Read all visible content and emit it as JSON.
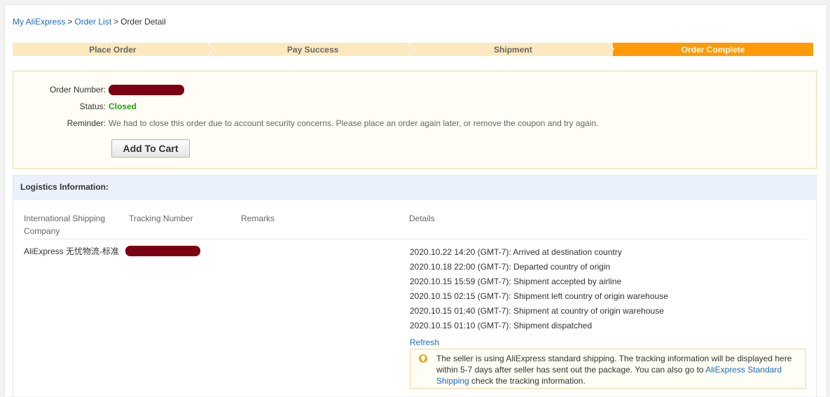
{
  "breadcrumb": {
    "home": "My AliExpress",
    "sep": ">",
    "orders": "Order List",
    "current": "Order Detail"
  },
  "steps": [
    "Place Order",
    "Pay Success",
    "Shipment",
    "Order Complete"
  ],
  "order": {
    "number_label": "Order Number:",
    "status_label": "Status:",
    "status_value": "Closed",
    "reminder_label": "Reminder:",
    "reminder_text": "We had to close this order due to account security concerns. Please place an order again later, or remove the coupon and try again.",
    "add_to_cart": "Add To Cart"
  },
  "logistics": {
    "title": "Logistics Information:",
    "headers": {
      "company_line1": "International Shipping",
      "company_line2": "Company",
      "tracking": "Tracking Number",
      "remarks": "Remarks",
      "details": "Details"
    },
    "company": "AliExpress 无忧物流-标准",
    "events": [
      "2020.10.22 14:20 (GMT-7): Arrived at destination country",
      "2020.10.18 22:00 (GMT-7): Departed country of origin",
      "2020.10.15 15:59 (GMT-7): Shipment accepted by airline",
      "2020.10.15 02:15 (GMT-7): Shipment left country of origin warehouse",
      "2020.10.15 01:40 (GMT-7): Shipment at country of origin warehouse",
      "2020.10.15 01:10 (GMT-7): Shipment dispatched"
    ],
    "refresh": "Refresh",
    "tip": {
      "text_before": "The seller is using AliExpress standard shipping. The tracking information will be displayed here within 5-7 days after seller has sent out the package. You can also go to ",
      "link": "AliExpress Standard Shipping",
      "text_after": " check the tracking information.",
      "icon": "bulb-icon"
    }
  },
  "colors": {
    "link": "#1a6bc6",
    "step_active": "#fe9a05",
    "step_inactive": "#fde9bf",
    "status_closed": "#26a014",
    "redaction": "#7b0012"
  }
}
